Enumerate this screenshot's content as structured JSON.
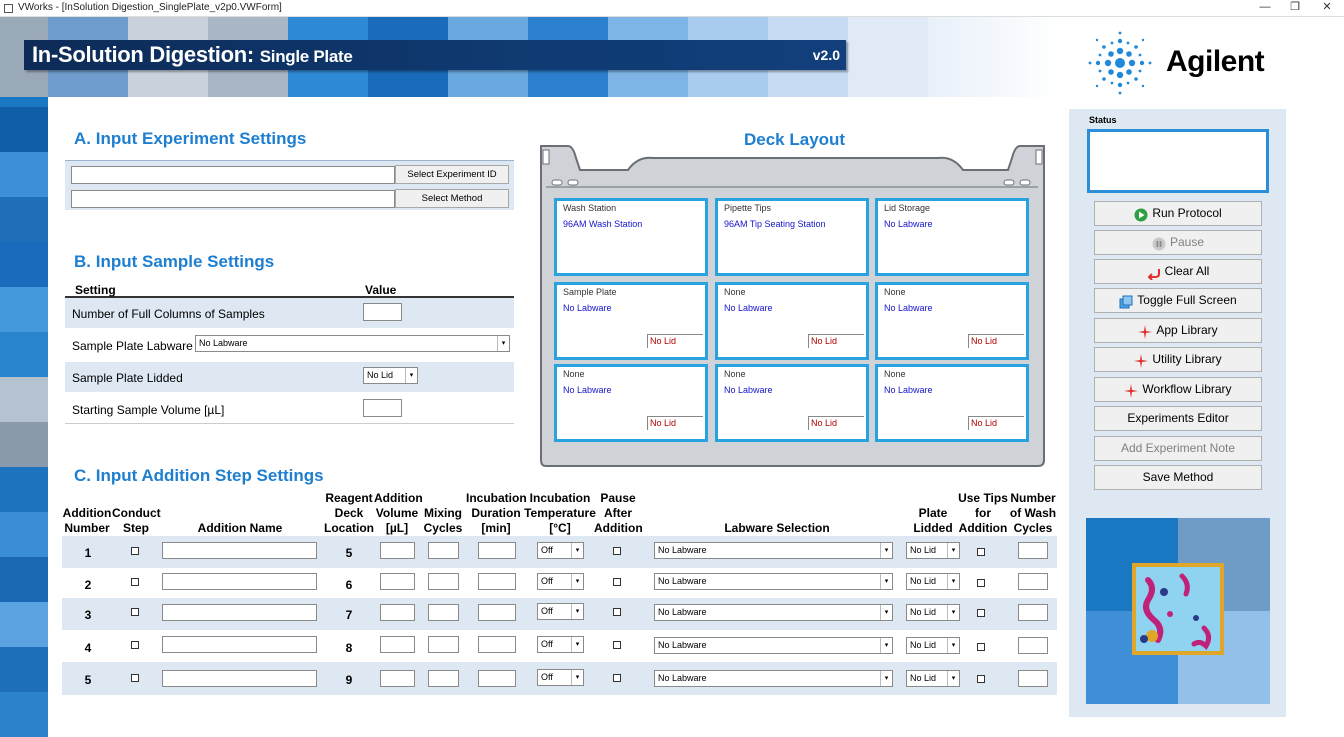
{
  "window": {
    "title": "VWorks - [InSolution Digestion_SinglePlate_v2p0.VWForm]",
    "controls": [
      "—",
      "❐",
      "✕"
    ]
  },
  "banner": {
    "title_main": "In-Solution Digestion:",
    "title_sub": "Single Plate",
    "version": "v2.0"
  },
  "logo": {
    "text": "Agilent"
  },
  "sectionA": {
    "title": "A. Input Experiment Settings",
    "experiment_id_value": "",
    "method_value": "",
    "select_experiment_label": "Select Experiment ID",
    "select_method_label": "Select Method"
  },
  "sectionB": {
    "title": "B. Input Sample Settings",
    "col_setting": "Setting",
    "col_value": "Value",
    "rows": [
      {
        "label": "Number of Full Columns of Samples",
        "value": ""
      },
      {
        "label": "Sample Plate Labware",
        "value": "No Labware"
      },
      {
        "label": "Sample Plate Lidded",
        "value": "No Lid"
      },
      {
        "label": "Starting Sample Volume [µL]",
        "value": ""
      }
    ]
  },
  "deck": {
    "title": "Deck Layout",
    "slots": [
      {
        "name": "Wash Station",
        "labware": "96AM Wash Station",
        "lid": ""
      },
      {
        "name": "Pipette Tips",
        "labware": "96AM Tip Seating Station",
        "lid": ""
      },
      {
        "name": "Lid Storage",
        "labware": "No Labware",
        "lid": ""
      },
      {
        "name": "Sample Plate",
        "labware": "No Labware",
        "lid": "No Lid"
      },
      {
        "name": "None",
        "labware": "No Labware",
        "lid": "No Lid"
      },
      {
        "name": "None",
        "labware": "No Labware",
        "lid": "No Lid"
      },
      {
        "name": "None",
        "labware": "No Labware",
        "lid": "No Lid"
      },
      {
        "name": "None",
        "labware": "No Labware",
        "lid": "No Lid"
      },
      {
        "name": "None",
        "labware": "No Labware",
        "lid": "No Lid"
      }
    ]
  },
  "sectionC": {
    "title": "C. Input Addition Step Settings",
    "headers": {
      "addition_number": "Addition Number",
      "conduct_step": "Conduct Step",
      "addition_name": "Addition Name",
      "reagent_deck": "Reagent Deck Location",
      "addition_volume": "Addition Volume [µL]",
      "mixing_cycles": "Mixing Cycles",
      "incubation_duration": "Incubation Duration [min]",
      "incubation_temp": "Incubation Temperature [°C]",
      "pause_after": "Pause After Addition",
      "labware_selection": "Labware Selection",
      "plate_lidded": "Plate Lidded",
      "use_tips": "Use Tips for Addition",
      "wash_cycles": "Number of Wash Cycles"
    },
    "rows": [
      {
        "num": "1",
        "deck": "5",
        "temp": "Off",
        "labware": "No Labware",
        "lid": "No Lid"
      },
      {
        "num": "2",
        "deck": "6",
        "temp": "Off",
        "labware": "No Labware",
        "lid": "No Lid"
      },
      {
        "num": "3",
        "deck": "7",
        "temp": "Off",
        "labware": "No Labware",
        "lid": "No Lid"
      },
      {
        "num": "4",
        "deck": "8",
        "temp": "Off",
        "labware": "No Labware",
        "lid": "No Lid"
      },
      {
        "num": "5",
        "deck": "9",
        "temp": "Off",
        "labware": "No Labware",
        "lid": "No Lid"
      }
    ]
  },
  "panel": {
    "status_label": "Status",
    "status_text": "",
    "buttons": [
      {
        "label": "Run Protocol",
        "icon": "play-icon",
        "enabled": true
      },
      {
        "label": "Pause",
        "icon": "pause-icon",
        "enabled": false
      },
      {
        "label": "Clear All",
        "icon": "undo-arrow-icon",
        "enabled": true
      },
      {
        "label": "Toggle Full Screen",
        "icon": "fullscreen-icon",
        "enabled": true
      },
      {
        "label": "App Library",
        "icon": "sparkle-icon",
        "enabled": true
      },
      {
        "label": "Utility Library",
        "icon": "sparkle-icon",
        "enabled": true
      },
      {
        "label": "Workflow Library",
        "icon": "sparkle-icon",
        "enabled": true
      },
      {
        "label": "Experiments Editor",
        "icon": "",
        "enabled": true
      },
      {
        "label": "Add Experiment Note",
        "icon": "",
        "enabled": false
      },
      {
        "label": "Save Method",
        "icon": "",
        "enabled": true
      }
    ]
  },
  "colors": {
    "accent": "#1e7fd0",
    "deck_border": "#29a3e0",
    "banner_bar": "#0f3a72",
    "status_border": "#2a8fd8"
  }
}
